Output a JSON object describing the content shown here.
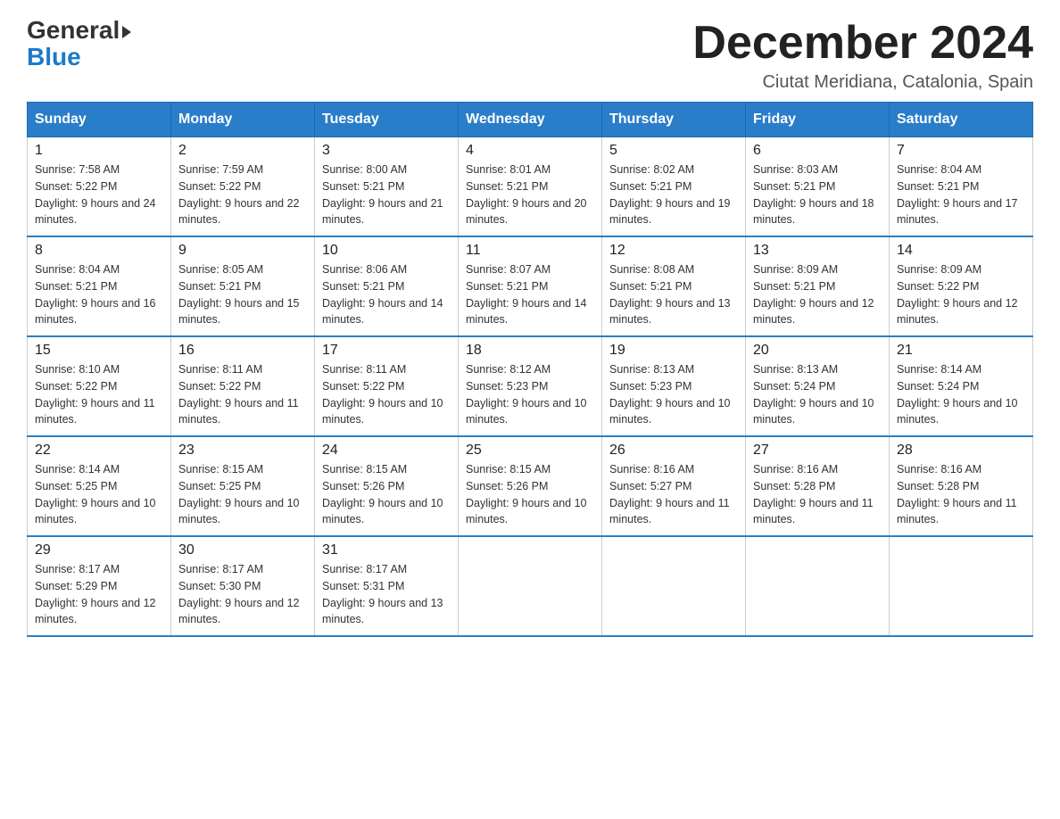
{
  "logo": {
    "general": "General",
    "blue": "Blue"
  },
  "header": {
    "title": "December 2024",
    "location": "Ciutat Meridiana, Catalonia, Spain"
  },
  "weekdays": [
    "Sunday",
    "Monday",
    "Tuesday",
    "Wednesday",
    "Thursday",
    "Friday",
    "Saturday"
  ],
  "weeks": [
    [
      {
        "day": "1",
        "sunrise": "7:58 AM",
        "sunset": "5:22 PM",
        "daylight": "9 hours and 24 minutes."
      },
      {
        "day": "2",
        "sunrise": "7:59 AM",
        "sunset": "5:22 PM",
        "daylight": "9 hours and 22 minutes."
      },
      {
        "day": "3",
        "sunrise": "8:00 AM",
        "sunset": "5:21 PM",
        "daylight": "9 hours and 21 minutes."
      },
      {
        "day": "4",
        "sunrise": "8:01 AM",
        "sunset": "5:21 PM",
        "daylight": "9 hours and 20 minutes."
      },
      {
        "day": "5",
        "sunrise": "8:02 AM",
        "sunset": "5:21 PM",
        "daylight": "9 hours and 19 minutes."
      },
      {
        "day": "6",
        "sunrise": "8:03 AM",
        "sunset": "5:21 PM",
        "daylight": "9 hours and 18 minutes."
      },
      {
        "day": "7",
        "sunrise": "8:04 AM",
        "sunset": "5:21 PM",
        "daylight": "9 hours and 17 minutes."
      }
    ],
    [
      {
        "day": "8",
        "sunrise": "8:04 AM",
        "sunset": "5:21 PM",
        "daylight": "9 hours and 16 minutes."
      },
      {
        "day": "9",
        "sunrise": "8:05 AM",
        "sunset": "5:21 PM",
        "daylight": "9 hours and 15 minutes."
      },
      {
        "day": "10",
        "sunrise": "8:06 AM",
        "sunset": "5:21 PM",
        "daylight": "9 hours and 14 minutes."
      },
      {
        "day": "11",
        "sunrise": "8:07 AM",
        "sunset": "5:21 PM",
        "daylight": "9 hours and 14 minutes."
      },
      {
        "day": "12",
        "sunrise": "8:08 AM",
        "sunset": "5:21 PM",
        "daylight": "9 hours and 13 minutes."
      },
      {
        "day": "13",
        "sunrise": "8:09 AM",
        "sunset": "5:21 PM",
        "daylight": "9 hours and 12 minutes."
      },
      {
        "day": "14",
        "sunrise": "8:09 AM",
        "sunset": "5:22 PM",
        "daylight": "9 hours and 12 minutes."
      }
    ],
    [
      {
        "day": "15",
        "sunrise": "8:10 AM",
        "sunset": "5:22 PM",
        "daylight": "9 hours and 11 minutes."
      },
      {
        "day": "16",
        "sunrise": "8:11 AM",
        "sunset": "5:22 PM",
        "daylight": "9 hours and 11 minutes."
      },
      {
        "day": "17",
        "sunrise": "8:11 AM",
        "sunset": "5:22 PM",
        "daylight": "9 hours and 10 minutes."
      },
      {
        "day": "18",
        "sunrise": "8:12 AM",
        "sunset": "5:23 PM",
        "daylight": "9 hours and 10 minutes."
      },
      {
        "day": "19",
        "sunrise": "8:13 AM",
        "sunset": "5:23 PM",
        "daylight": "9 hours and 10 minutes."
      },
      {
        "day": "20",
        "sunrise": "8:13 AM",
        "sunset": "5:24 PM",
        "daylight": "9 hours and 10 minutes."
      },
      {
        "day": "21",
        "sunrise": "8:14 AM",
        "sunset": "5:24 PM",
        "daylight": "9 hours and 10 minutes."
      }
    ],
    [
      {
        "day": "22",
        "sunrise": "8:14 AM",
        "sunset": "5:25 PM",
        "daylight": "9 hours and 10 minutes."
      },
      {
        "day": "23",
        "sunrise": "8:15 AM",
        "sunset": "5:25 PM",
        "daylight": "9 hours and 10 minutes."
      },
      {
        "day": "24",
        "sunrise": "8:15 AM",
        "sunset": "5:26 PM",
        "daylight": "9 hours and 10 minutes."
      },
      {
        "day": "25",
        "sunrise": "8:15 AM",
        "sunset": "5:26 PM",
        "daylight": "9 hours and 10 minutes."
      },
      {
        "day": "26",
        "sunrise": "8:16 AM",
        "sunset": "5:27 PM",
        "daylight": "9 hours and 11 minutes."
      },
      {
        "day": "27",
        "sunrise": "8:16 AM",
        "sunset": "5:28 PM",
        "daylight": "9 hours and 11 minutes."
      },
      {
        "day": "28",
        "sunrise": "8:16 AM",
        "sunset": "5:28 PM",
        "daylight": "9 hours and 11 minutes."
      }
    ],
    [
      {
        "day": "29",
        "sunrise": "8:17 AM",
        "sunset": "5:29 PM",
        "daylight": "9 hours and 12 minutes."
      },
      {
        "day": "30",
        "sunrise": "8:17 AM",
        "sunset": "5:30 PM",
        "daylight": "9 hours and 12 minutes."
      },
      {
        "day": "31",
        "sunrise": "8:17 AM",
        "sunset": "5:31 PM",
        "daylight": "9 hours and 13 minutes."
      },
      null,
      null,
      null,
      null
    ]
  ]
}
